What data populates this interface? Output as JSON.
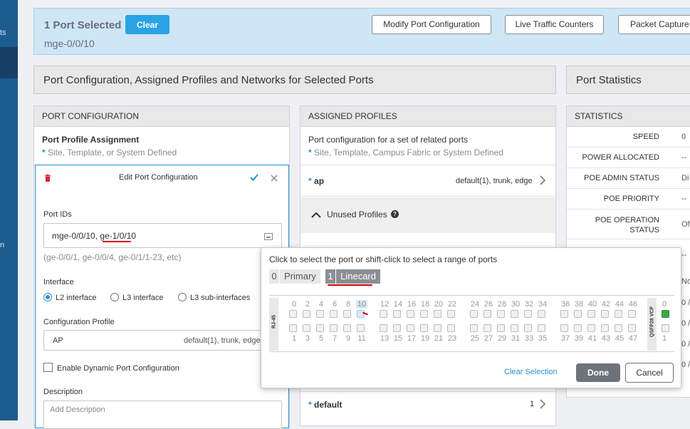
{
  "nav": {
    "items": [
      {
        "label": "ts"
      },
      {
        "label": "n"
      }
    ]
  },
  "banner": {
    "selected_title": "1 Port Selected",
    "clear_label": "Clear",
    "port": "mge-0/0/10",
    "buttons": [
      "Modify Port Configuration",
      "Live Traffic Counters",
      "Packet Capture"
    ]
  },
  "sections": {
    "main_title": "Port Configuration, Assigned Profiles and Networks for Selected Ports",
    "stats_title": "Port Statistics"
  },
  "port_config": {
    "header": "PORT CONFIGURATION",
    "assignment_title": "Port Profile Assignment",
    "assignment_sub": "Site, Template, or System Defined",
    "edit_title": "Edit Port Configuration",
    "port_ids_label": "Port IDs",
    "port_ids_value": "mge-0/0/10, ge-1/0/10",
    "port_ids_hint": "(ge-0/0/1, ge-0/0/4, ge-0/1/1-23, etc)",
    "interface_label": "Interface",
    "interface_options": [
      "L2 interface",
      "L3 interface",
      "L3 sub-interfaces"
    ],
    "profile_label": "Configuration Profile",
    "profile_name": "AP",
    "profile_detail": "default(1), trunk, edge",
    "dynamic_label": "Enable Dynamic Port Configuration",
    "description_label": "Description",
    "description_placeholder": "Add Description"
  },
  "assigned": {
    "header": "ASSIGNED PROFILES",
    "desc": "Port configuration for a set of related ports",
    "desc_sub": "Site, Template, Campus Fabric or System Defined",
    "ap_name": "ap",
    "ap_detail": "default(1), trunk, edge",
    "unused_label": "Unused Profiles",
    "default_name": "default",
    "default_count": "1"
  },
  "stats": {
    "header": "STATISTICS",
    "rows": [
      {
        "key": "SPEED",
        "val": "0"
      },
      {
        "key": "POWER ALLOCATED",
        "val": "--"
      },
      {
        "key": "POE ADMIN STATUS",
        "val": "Di"
      },
      {
        "key": "POE PRIORITY",
        "val": "--"
      },
      {
        "key": "POE OPERATION STATUS",
        "val": "Of"
      }
    ],
    "partial": [
      "--",
      "No",
      "0 /",
      "0 /",
      "0 /",
      "0 /"
    ]
  },
  "picker": {
    "instruction": "Click to select the port or shift-click to select a range of ports",
    "tabs": [
      {
        "num": "0",
        "label": "Primary"
      },
      {
        "num": "1",
        "label": "Linecard"
      }
    ],
    "rj45_label": "RJ-45",
    "qsfp_label": "QSFP28 VCP",
    "top_nums": [
      "0",
      "2",
      "4",
      "6",
      "8",
      "10",
      "12",
      "14",
      "16",
      "18",
      "20",
      "22",
      "24",
      "26",
      "28",
      "30",
      "32",
      "34",
      "36",
      "38",
      "40",
      "42",
      "44",
      "46"
    ],
    "bottom_nums": [
      "1",
      "3",
      "5",
      "7",
      "9",
      "11",
      "13",
      "15",
      "17",
      "19",
      "21",
      "23",
      "25",
      "27",
      "29",
      "31",
      "33",
      "35",
      "37",
      "39",
      "41",
      "43",
      "45",
      "47"
    ],
    "qsfp_top": "0",
    "qsfp_bottom": "1",
    "clear_selection": "Clear Selection",
    "done": "Done",
    "cancel": "Cancel"
  },
  "colors": {
    "accent": "#2aa3e6",
    "banner_bg": "#cfe6f7",
    "nav_bg": "#1d5c8f",
    "annotation": "#d40000"
  }
}
